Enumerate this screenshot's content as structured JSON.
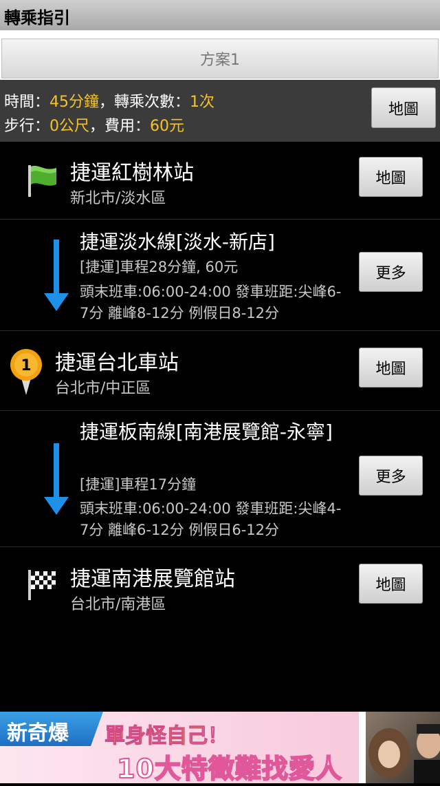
{
  "header": {
    "title": "轉乘指引"
  },
  "plan_tab": {
    "label": "方案1"
  },
  "summary": {
    "time_label": "時間：",
    "time_value": "45分鐘",
    "sep1": "，",
    "transfer_label": "轉乘次數：",
    "transfer_value": "1次",
    "walk_label": "步行：",
    "walk_value": "0公尺",
    "sep2": "，",
    "fee_label": "費用：",
    "fee_value": "60元",
    "map_button": "地圖"
  },
  "steps": [
    {
      "type": "station",
      "icon": "green-flag-icon",
      "name": "捷運紅樹林站",
      "district": "新北市/淡水區",
      "button": "地圖"
    },
    {
      "type": "line",
      "icon": "down-arrow-icon",
      "name": "捷運淡水線[淡水-新店]",
      "info": "[捷運]車程28分鐘, 60元",
      "schedule": "頭末班車:06:00-24:00  發車班距:尖峰6-7分 離峰8-12分 例假日8-12分",
      "button": "更多"
    },
    {
      "type": "station",
      "icon": "transfer-pin-icon",
      "pin_label": "1",
      "name": "捷運台北車站",
      "district": "台北市/中正區",
      "button": "地圖"
    },
    {
      "type": "line",
      "icon": "down-arrow-icon",
      "name": "捷運板南線[南港展覽館-永寧]",
      "info": "[捷運]車程17分鐘",
      "schedule": "頭末班車:06:00-24:00  發車班距:尖峰4-7分 離峰6-12分 例假日6-12分",
      "button": "更多"
    },
    {
      "type": "station",
      "icon": "checkered-flag-icon",
      "name": "捷運南港展覽館站",
      "district": "台北市/南港區",
      "button": "地圖"
    }
  ],
  "ad": {
    "tag": "新奇爆",
    "line1": "單身怪自己！",
    "line2": "10大特徵難找愛人"
  },
  "colors": {
    "highlight": "#f6c22c",
    "arrow": "#1e90e8",
    "flag_green": "#4fae2e",
    "pin": "#f2a20c"
  }
}
